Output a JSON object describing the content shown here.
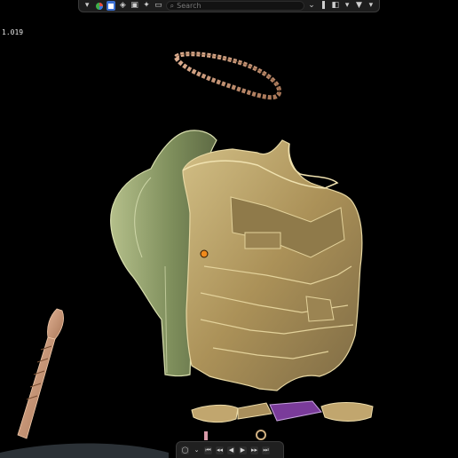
{
  "viewport": {
    "overlay_value": "1.019"
  },
  "header_toolbar": {
    "search_placeholder": "Search",
    "icons": [
      "chevron-down-icon",
      "rainbow-material-icon",
      "object-mode-icon",
      "layers-icon",
      "image-icon",
      "lightbulb-icon",
      "folder-icon",
      "search-icon",
      "collapse-icon",
      "bookmark-icon",
      "display-toggle-icon",
      "chevron-down-icon",
      "filter-icon",
      "chevron-down-icon"
    ]
  },
  "playback": {
    "icons": [
      "record-icon",
      "chevron-down-icon",
      "jump-to-start-icon",
      "jump-back-icon",
      "play-reverse-icon",
      "play-icon",
      "jump-forward-icon",
      "jump-to-end-icon"
    ]
  },
  "colors": {
    "armor_gold": "#b09a62",
    "backpiece_green": "#8fa06a",
    "chain_copper": "#c8956f",
    "glasses_purple": "#7a3b9a",
    "ui_accent": "#3b6fd1"
  }
}
